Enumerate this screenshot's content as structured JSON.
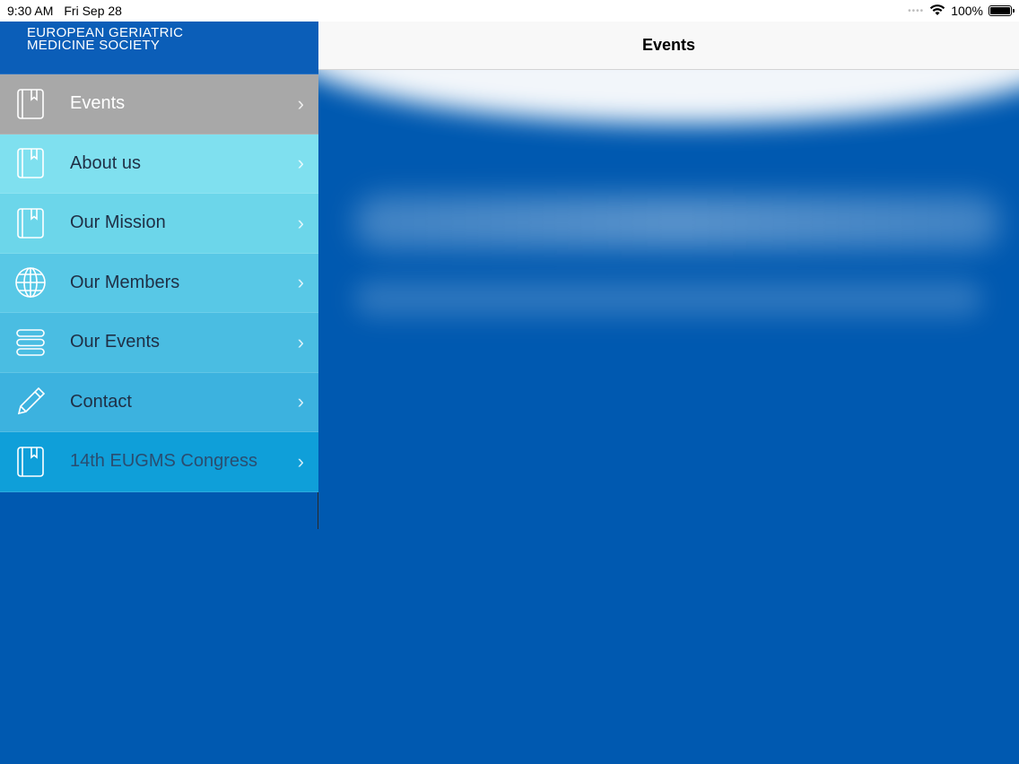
{
  "status": {
    "time": "9:30 AM",
    "date": "Fri Sep 28",
    "battery": "100%"
  },
  "nav": {
    "title": "Events"
  },
  "sidebar": {
    "logo_line1": "EUROPEAN GERIATRIC",
    "logo_line2": "MEDICINE SOCIETY",
    "items": [
      {
        "label": "Events",
        "icon": "book-icon"
      },
      {
        "label": "About us",
        "icon": "book-icon"
      },
      {
        "label": "Our Mission",
        "icon": "book-icon"
      },
      {
        "label": "Our Members",
        "icon": "globe-icon"
      },
      {
        "label": "Our Events",
        "icon": "stack-icon"
      },
      {
        "label": "Contact",
        "icon": "pencil-icon"
      },
      {
        "label": "14th EUGMS Congress",
        "icon": "book-icon"
      }
    ]
  },
  "colors": {
    "background": "#0059b0",
    "active_item": "#a8a8a8",
    "menu_light": "#7fe0ef",
    "menu_dark": "#0f9fd9"
  }
}
